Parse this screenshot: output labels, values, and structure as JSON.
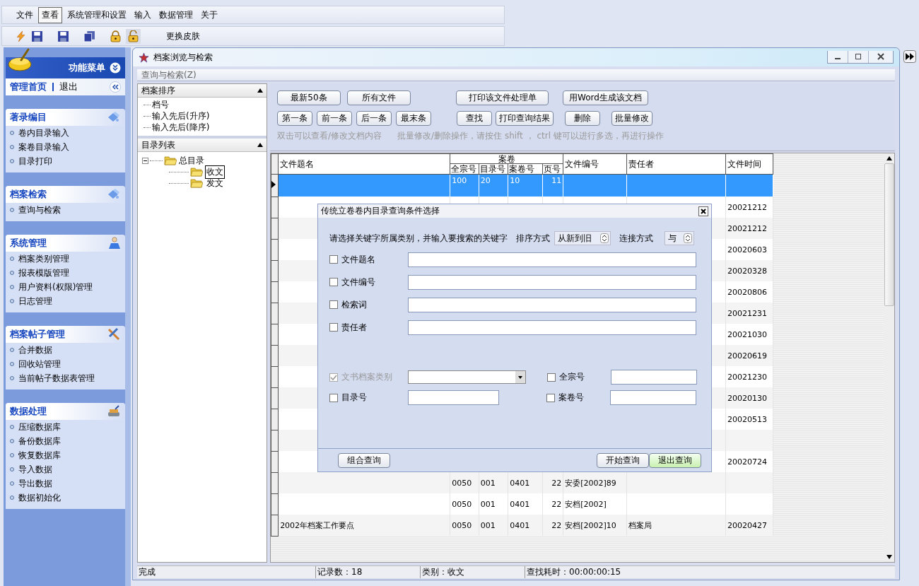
{
  "menu_bar": [
    {
      "label": "文件",
      "selected": false
    },
    {
      "label": "查看",
      "selected": true
    },
    {
      "label": "系统管理和设置",
      "selected": false
    },
    {
      "label": "输入",
      "selected": false
    },
    {
      "label": "数据管理",
      "selected": false
    },
    {
      "label": "关于",
      "selected": false
    }
  ],
  "toolbar": {
    "skin_button": "更换皮肤"
  },
  "sidebar": {
    "title": "功能菜单",
    "home": "管理首页",
    "logout": "退出",
    "groups": [
      {
        "title": "著录编目",
        "kind": "catalog",
        "items": [
          "卷内目录输入",
          "案卷目录输入",
          "目录打印"
        ]
      },
      {
        "title": "档案检索",
        "kind": "catalog",
        "items": [
          "查询与检索"
        ]
      },
      {
        "title": "系统管理",
        "kind": "person",
        "items": [
          "档案类别管理",
          "报表模版管理",
          "用户资料(权限)管理",
          "日志管理"
        ]
      },
      {
        "title": "档案帖子管理",
        "kind": "tools",
        "items": [
          "合并数据",
          "回收站管理",
          "当前帖子数据表管理"
        ]
      },
      {
        "title": "数据处理",
        "kind": "disk",
        "items": [
          "压缩数据库",
          "备份数据库",
          "恢复数据库",
          "导入数据",
          "导出数据",
          "数据初始化"
        ]
      }
    ]
  },
  "window": {
    "title": "档案浏览与检索",
    "menu": "查询与检索(Z)",
    "sort_panel": {
      "title": "档案排序",
      "items": [
        "档号",
        "输入先后(升序)",
        "输入先后(降序)"
      ]
    },
    "catalog_panel": {
      "title": "目录列表",
      "tree": [
        {
          "label": "总目录",
          "expanded": true,
          "children": [
            {
              "label": "收文",
              "selected": true
            },
            {
              "label": "发文",
              "selected": false
            }
          ]
        }
      ]
    },
    "buttons_row1": [
      "最新50条",
      "所有文件",
      "打印该文件处理单",
      "用Word生成该文档"
    ],
    "buttons_row2": [
      "第一条",
      "前一条",
      "后一条",
      "最末条",
      "查找",
      "打印查询结果",
      "删除",
      "批量修改"
    ],
    "hints": [
      "双击可以查看/修改文档内容",
      "批量修改/删除操作，请按住 shift ， ctrl 键可以进行多选，再进行操作"
    ],
    "table": {
      "columns": [
        "文件题名",
        "全宗号",
        "目录号",
        "案卷号",
        "页号",
        "文件编号",
        "责任者",
        "文件时间"
      ],
      "group_header": "案卷",
      "rows": [
        {
          "selected": true,
          "cells": [
            "",
            "100",
            "20",
            "10",
            "11",
            "",
            "",
            ""
          ]
        },
        {
          "selected": false,
          "cells": [
            "",
            "",
            "",
            "",
            "",
            "",
            "",
            "20021212"
          ]
        },
        {
          "selected": false,
          "cells": [
            "",
            "",
            "",
            "",
            "",
            "",
            "",
            "20021212"
          ]
        },
        {
          "selected": false,
          "cells": [
            "",
            "",
            "",
            "",
            "",
            "",
            "",
            "20020603"
          ]
        },
        {
          "selected": false,
          "cells": [
            "",
            "",
            "",
            "",
            "",
            "",
            "",
            "20020328"
          ]
        },
        {
          "selected": false,
          "cells": [
            "",
            "",
            "",
            "",
            "",
            "",
            "",
            "20020806"
          ]
        },
        {
          "selected": false,
          "cells": [
            "",
            "",
            "",
            "",
            "",
            "",
            "",
            "20021231"
          ]
        },
        {
          "selected": false,
          "cells": [
            "",
            "",
            "",
            "",
            "",
            "",
            "",
            "20021030"
          ]
        },
        {
          "selected": false,
          "cells": [
            "",
            "",
            "",
            "",
            "",
            "",
            "",
            "20020619"
          ]
        },
        {
          "selected": false,
          "cells": [
            "",
            "",
            "",
            "",
            "",
            "",
            "",
            "20021230"
          ]
        },
        {
          "selected": false,
          "cells": [
            "",
            "",
            "",
            "",
            "",
            "",
            "",
            "20020130"
          ]
        },
        {
          "selected": false,
          "cells": [
            "",
            "",
            "",
            "",
            "",
            "",
            "",
            "20020513"
          ]
        },
        {
          "selected": false,
          "cells": [
            "",
            "",
            "",
            "",
            "",
            "",
            "",
            ""
          ]
        },
        {
          "selected": false,
          "cells": [
            "",
            "",
            "",
            "",
            "",
            "",
            "",
            "20020724"
          ]
        },
        {
          "selected": false,
          "cells": [
            "",
            "0050",
            "001",
            "0401",
            "22",
            "安委[2002]89",
            "",
            ""
          ]
        },
        {
          "selected": false,
          "cells": [
            "",
            "0050",
            "001",
            "0401",
            "22",
            "安档[2002]",
            "",
            ""
          ]
        },
        {
          "selected": false,
          "cells": [
            "2002年档案工作要点",
            "0050",
            "001",
            "0401",
            "22",
            "安档[2002]10",
            "档案局",
            "20020427"
          ]
        }
      ]
    },
    "status_bar": [
      "完成",
      "记录数：18",
      "类别：收文",
      "查找耗时：00:00:00:15"
    ]
  },
  "dialog": {
    "title": "传统立卷卷内目录查询条件选择",
    "prompt": "请选择关键字所属类别，并输入要搜索的关键字",
    "sort_label": "排序方式",
    "sort_value": "从新到旧",
    "join_label": "连接方式",
    "join_value": "与",
    "fields": [
      {
        "label": "文件题名",
        "checked": false
      },
      {
        "label": "文件编号",
        "checked": false
      },
      {
        "label": "检索词",
        "checked": false
      },
      {
        "label": "责任者",
        "checked": false
      }
    ],
    "category": {
      "label": "文书档案类别",
      "checked": true,
      "disabled": true
    },
    "extra_fields": [
      {
        "label": "全宗号",
        "checked": false
      },
      {
        "label": "目录号",
        "checked": false
      },
      {
        "label": "案卷号",
        "checked": false
      }
    ],
    "buttons": [
      {
        "label": "组合查询",
        "focused": false
      },
      {
        "label": "开始查询",
        "focused": false
      },
      {
        "label": "退出查询",
        "focused": true
      }
    ]
  }
}
